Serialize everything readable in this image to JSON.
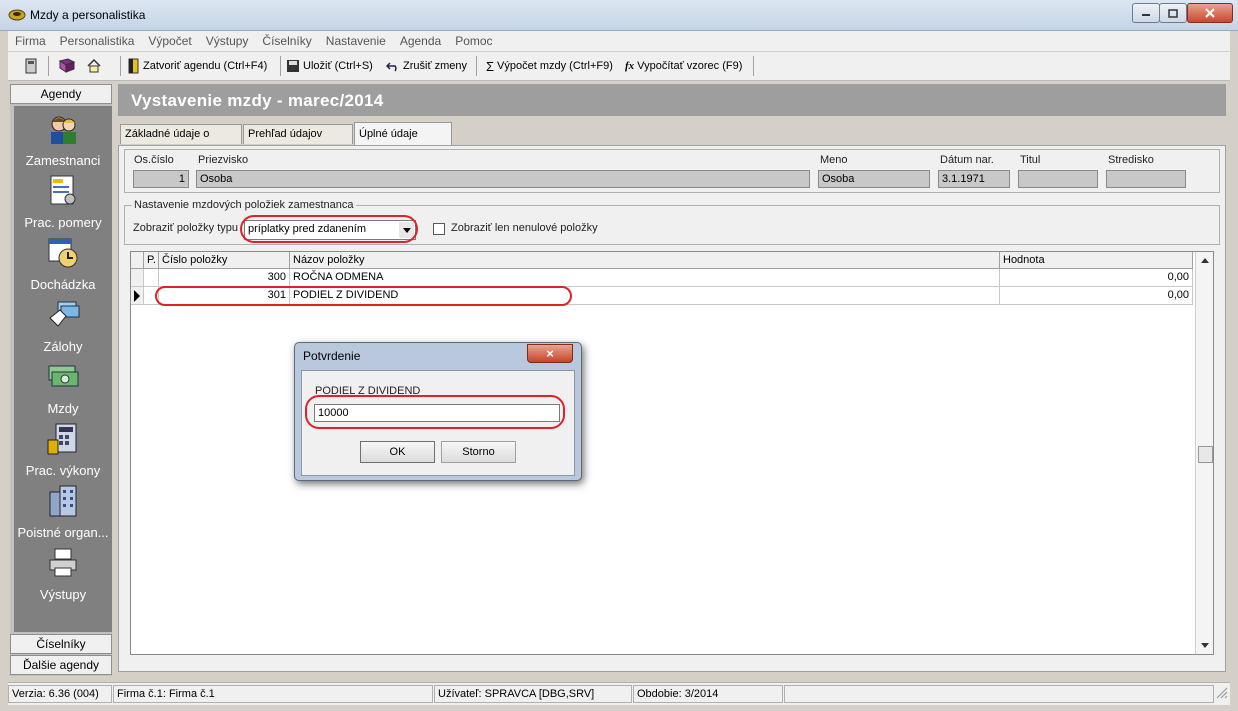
{
  "window": {
    "title": "Mzdy a personalistika"
  },
  "menu": [
    "Firma",
    "Personalistika",
    "Výpočet",
    "Výstupy",
    "Číselníky",
    "Nastavenie",
    "Agenda",
    "Pomoc"
  ],
  "toolbar": {
    "close_agenda": "Zatvoriť agendu (Ctrl+F4)",
    "save": "Uložiť (Ctrl+S)",
    "undo": "Zrušiť zmeny",
    "calc_wage": "Výpočet mzdy (Ctrl+F9)",
    "calc_formula": "Vypočítať vzorec (F9)"
  },
  "sidebar": {
    "header": "Agendy",
    "items": [
      "Zamestnanci",
      "Prac. pomery",
      "Dochádzka",
      "Zálohy",
      "Mzdy",
      "Prac. výkony",
      "Poistné organ...",
      "Výstupy"
    ],
    "footer1": "Číselníky",
    "footer2": "Ďalšie agendy"
  },
  "main": {
    "title": "Vystavenie mzdy - marec/2014",
    "tabs": [
      "Základné údaje o mzde",
      "Prehľad údajov mzdy",
      "Úplné údaje mzdy"
    ]
  },
  "employee": {
    "labels": {
      "os_cislo": "Os.číslo",
      "priezvisko": "Priezvisko",
      "meno": "Meno",
      "datum": "Dátum nar.",
      "titul": "Titul",
      "stredisko": "Stredisko"
    },
    "values": {
      "os_cislo": "1",
      "priezvisko": "Osoba",
      "meno": "Osoba",
      "datum": "3.1.1971",
      "titul": "",
      "stredisko": ""
    }
  },
  "settings": {
    "group_label": "Nastavenie mzdových položiek zamestnanca",
    "type_label": "Zobraziť položky typu",
    "type_value": "príplatky pred zdanením",
    "nonzero_label": "Zobraziť len nenulové položky"
  },
  "grid": {
    "headers": [
      "P.",
      "Číslo položky",
      "Názov položky",
      "Hodnota"
    ],
    "rows": [
      {
        "p": "",
        "cislo": "300",
        "nazov": "ROČNA ODMENA",
        "hodnota": "0,00"
      },
      {
        "p": "",
        "cislo": "301",
        "nazov": "PODIEL Z DIVIDEND",
        "hodnota": "0,00"
      }
    ]
  },
  "dialog": {
    "title": "Potvrdenie",
    "label": "PODIEL Z DIVIDEND",
    "value": "10000",
    "ok": "OK",
    "cancel": "Storno"
  },
  "status": {
    "version": "Verzia: 6.36 (004)",
    "company": "Firma č.1: Firma č.1",
    "user": "Užívateľ: SPRAVCA [DBG,SRV]",
    "period": "Obdobie: 3/2014"
  }
}
